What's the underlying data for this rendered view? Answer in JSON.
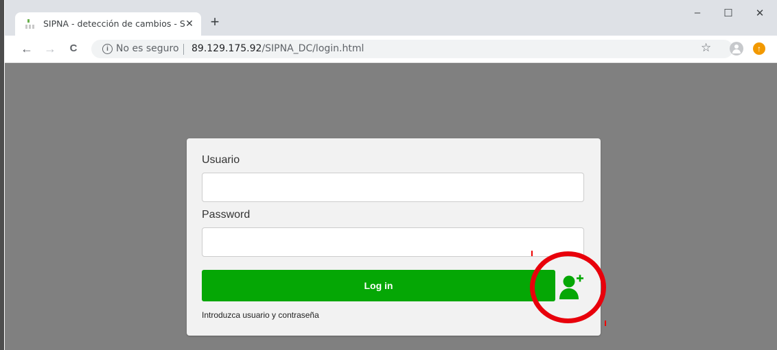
{
  "browser": {
    "tab_title": "SIPNA - detección de cambios - S",
    "tab_close_glyph": "✕",
    "new_tab_glyph": "+",
    "window_controls": {
      "minimize": "–",
      "maximize": "☐",
      "close": "✕"
    },
    "nav": {
      "back": "←",
      "forward": "→",
      "reload": "C"
    },
    "security_text": "No es seguro",
    "info_glyph": "i",
    "url_host": "89.129.175.92",
    "url_path": "/SIPNA_DC/login.html",
    "bookmark_glyph": "☆",
    "update_glyph": "↑"
  },
  "login": {
    "username_label": "Usuario",
    "username_value": "",
    "password_label": "Password",
    "password_value": "",
    "button_label": "Log in",
    "hint": "Introduzca usuario y contraseña"
  },
  "colors": {
    "button_green": "#05a705",
    "page_background": "#808080",
    "highlight_red": "#e8000b"
  },
  "icons": [
    "favicon-icon",
    "close-icon",
    "plus-icon",
    "minimize-icon",
    "maximize-icon",
    "back-icon",
    "forward-icon",
    "reload-icon",
    "info-icon",
    "star-icon",
    "profile-icon",
    "update-icon",
    "add-user-icon"
  ]
}
